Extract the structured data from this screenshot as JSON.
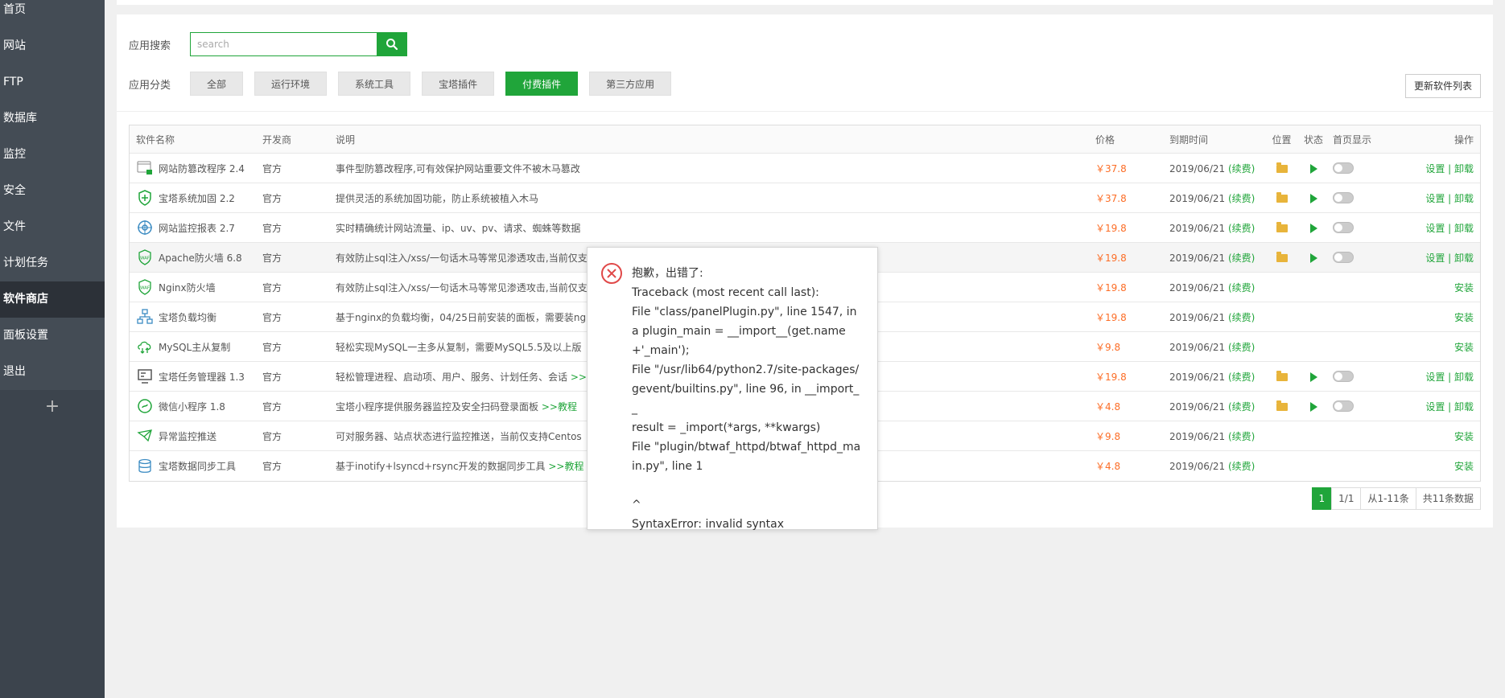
{
  "sidebar": {
    "items": [
      {
        "label": "首页"
      },
      {
        "label": "网站"
      },
      {
        "label": "FTP"
      },
      {
        "label": "数据库"
      },
      {
        "label": "监控"
      },
      {
        "label": "安全"
      },
      {
        "label": "文件"
      },
      {
        "label": "计划任务"
      },
      {
        "label": "软件商店",
        "active": true
      },
      {
        "label": "面板设置"
      },
      {
        "label": "退出"
      }
    ],
    "add_label": "+"
  },
  "search": {
    "label": "应用搜索",
    "placeholder": "search"
  },
  "categories": {
    "label": "应用分类",
    "items": [
      "全部",
      "运行环境",
      "系统工具",
      "宝塔插件",
      "付费插件",
      "第三方应用"
    ],
    "active": "付费插件"
  },
  "update_button": "更新软件列表",
  "table": {
    "headers": {
      "name": "软件名称",
      "dev": "开发商",
      "desc": "说明",
      "price": "价格",
      "expire": "到期时间",
      "pos": "位置",
      "status": "状态",
      "home": "首页显示",
      "op": "操作"
    },
    "rows": [
      {
        "icon": "tamper-proof-icon",
        "name": "网站防篡改程序 2.4",
        "dev": "官方",
        "desc": "事件型防篡改程序,可有效保护网站重要文件不被木马篡改",
        "tutorial": "",
        "price": "￥37.8",
        "expire": "2019/06/21",
        "renew": "(续费)",
        "installed": true,
        "op": "设置 | 卸载"
      },
      {
        "icon": "shield-icon",
        "name": "宝塔系统加固 2.2",
        "dev": "官方",
        "desc": "提供灵活的系统加固功能，防止系统被植入木马",
        "tutorial": "",
        "price": "￥37.8",
        "expire": "2019/06/21",
        "renew": "(续费)",
        "installed": true,
        "op": "设置 | 卸载"
      },
      {
        "icon": "monitor-report-icon",
        "name": "网站监控报表 2.7",
        "dev": "官方",
        "desc": "实时精确统计网站流量、ip、uv、pv、请求、蜘蛛等数据",
        "tutorial": "",
        "price": "￥19.8",
        "expire": "2019/06/21",
        "renew": "(续费)",
        "installed": true,
        "op": "设置 | 卸载"
      },
      {
        "icon": "waf-icon",
        "name": "Apache防火墙 6.8",
        "dev": "官方",
        "desc": "有效防止sql注入/xss/一句话木马等常见渗透攻击,当前仅支",
        "tutorial": "",
        "price": "￥19.8",
        "expire": "2019/06/21",
        "renew": "(续费)",
        "installed": true,
        "op": "设置 | 卸载"
      },
      {
        "icon": "waf-icon",
        "name": "Nginx防火墙",
        "dev": "官方",
        "desc": "有效防止sql注入/xss/一句话木马等常见渗透攻击,当前仅支",
        "tutorial": "",
        "price": "￥19.8",
        "expire": "2019/06/21",
        "renew": "(续费)",
        "installed": false,
        "op": "安装"
      },
      {
        "icon": "load-balance-icon",
        "name": "宝塔负载均衡",
        "dev": "官方",
        "desc": "基于nginx的负载均衡，04/25日前安装的面板，需要装ng",
        "tutorial": "",
        "price": "￥19.8",
        "expire": "2019/06/21",
        "renew": "(续费)",
        "installed": false,
        "op": "安装"
      },
      {
        "icon": "mysql-replication-icon",
        "name": "MySQL主从复制",
        "dev": "官方",
        "desc": "轻松实现MySQL一主多从复制，需要MySQL5.5及以上版",
        "tutorial": "",
        "price": "￥9.8",
        "expire": "2019/06/21",
        "renew": "(续费)",
        "installed": false,
        "op": "安装"
      },
      {
        "icon": "task-manager-icon",
        "name": "宝塔任务管理器 1.3",
        "dev": "官方",
        "desc": "轻松管理进程、启动项、用户、服务、计划任务、会话 ",
        "tutorial": ">>",
        "price": "￥19.8",
        "expire": "2019/06/21",
        "renew": "(续费)",
        "installed": true,
        "op": "设置 | 卸载"
      },
      {
        "icon": "mini-program-icon",
        "name": "微信小程序 1.8",
        "dev": "官方",
        "desc": "宝塔小程序提供服务器监控及安全扫码登录面板 ",
        "tutorial": ">>教程",
        "price": "￥4.8",
        "expire": "2019/06/21",
        "renew": "(续费)",
        "installed": true,
        "op": "设置 | 卸载"
      },
      {
        "icon": "alert-push-icon",
        "name": "异常监控推送",
        "dev": "官方",
        "desc": "可对服务器、站点状态进行监控推送，当前仅支持Centos",
        "tutorial": "",
        "price": "￥9.8",
        "expire": "2019/06/21",
        "renew": "(续费)",
        "installed": false,
        "op": "安装"
      },
      {
        "icon": "data-sync-icon",
        "name": "宝塔数据同步工具",
        "dev": "官方",
        "desc": "基于inotify+lsyncd+rsync开发的数据同步工具 ",
        "tutorial": ">>教程",
        "price": "￥4.8",
        "expire": "2019/06/21",
        "renew": "(续费)",
        "installed": false,
        "op": "安装"
      }
    ]
  },
  "pagination": {
    "current": "1",
    "pages": "1/1",
    "range": "从1-11条",
    "total": "共11条数据"
  },
  "error_popup": {
    "title": "抱歉，出错了:",
    "body": "Traceback (most recent call last):\nFile \"class/panelPlugin.py\", line 1547, in a plugin_main = __import__(get.name+'_main');\nFile \"/usr/lib64/python2.7/site-packages/gevent/builtins.py\", line 96, in __import__\nresult = _import(*args, **kwargs)\nFile \"plugin/btwaf_httpd/btwaf_httpd_main.py\", line 1\n\n^\nSyntaxError: invalid syntax"
  },
  "colors": {
    "accent": "#20a53a",
    "price": "#fc6d26",
    "sidebar": "#444c55",
    "error": "#e04848"
  }
}
